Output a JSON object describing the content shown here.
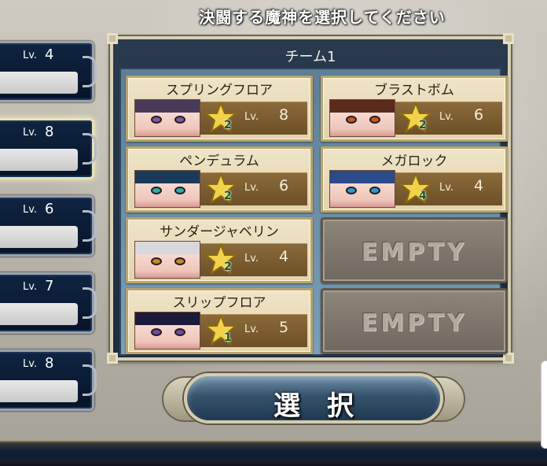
{
  "title": "決闘する魔神を選択してください",
  "lv_label": "Lv.",
  "left_list": [
    {
      "level": "4",
      "active": false
    },
    {
      "level": "8",
      "active": true
    },
    {
      "level": "6",
      "active": false
    },
    {
      "level": "7",
      "active": false
    },
    {
      "level": "8",
      "active": false
    }
  ],
  "team": {
    "label": "チーム1",
    "slots": [
      {
        "name": "スプリングフロア",
        "rank": "2",
        "level": "8",
        "hair": "#4a3a5a",
        "eyes": "#7a5aa0"
      },
      {
        "name": "ブラストボム",
        "rank": "2",
        "level": "6",
        "hair": "#5a2a1a",
        "eyes": "#c45a20"
      },
      {
        "name": "ペンデュラム",
        "rank": "2",
        "level": "6",
        "hair": "#1a3a5a",
        "eyes": "#2ab0b0"
      },
      {
        "name": "メガロック",
        "rank": "4",
        "level": "4",
        "hair": "#2a4a8a",
        "eyes": "#2a9ad0"
      },
      {
        "name": "サンダージャベリン",
        "rank": "2",
        "level": "4",
        "hair": "#d8d8dc",
        "eyes": "#c08a2a"
      },
      {
        "empty": "EMPTY"
      },
      {
        "name": "スリップフロア",
        "rank": "1",
        "level": "5",
        "hair": "#1a1a3a",
        "eyes": "#6a4aa0"
      },
      {
        "empty": "EMPTY"
      }
    ]
  },
  "select_button": {
    "label": "選択"
  },
  "colors": {
    "panel_border": "#d8d0b4",
    "card_level_bar": "#7a5a30",
    "button_blue": "#35536c"
  }
}
